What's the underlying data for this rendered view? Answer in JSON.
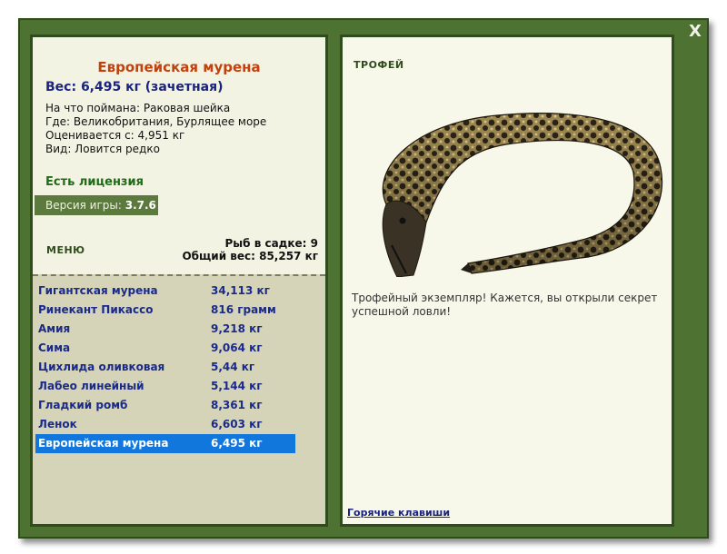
{
  "window": {
    "close_label": "X"
  },
  "fish": {
    "title": "Европейская мурена",
    "weight": "Вес: 6,495 кг (зачетная)",
    "caught_on": "На что поймана: Раковая шейка",
    "location": "Где: Великобритания, Бурлящее море",
    "valued_from": "Оценивается с: 4,951 кг",
    "rarity": "Вид: Ловится редко"
  },
  "license": "Есть лицензия",
  "version": {
    "label": "Версия игры:",
    "value": "3.7.6"
  },
  "menu_label": "МЕНЮ",
  "stats": {
    "fish_count": "Рыб в садке: 9",
    "total_weight": "Общий вес: 85,257 кг"
  },
  "catch_list": [
    {
      "name": "Гигантская мурена",
      "weight": "34,113 кг"
    },
    {
      "name": "Ринекант Пикассо",
      "weight": "816 грамм"
    },
    {
      "name": "Амия",
      "weight": "9,218 кг"
    },
    {
      "name": "Сима",
      "weight": "9,064 кг"
    },
    {
      "name": "Цихлида оливковая",
      "weight": "5,44 кг"
    },
    {
      "name": "Лабео линейный",
      "weight": "5,144 кг"
    },
    {
      "name": "Гладкий ромб",
      "weight": "8,361 кг"
    },
    {
      "name": "Ленок",
      "weight": "6,603 кг"
    },
    {
      "name": "Европейская мурена",
      "weight": "6,495 кг"
    }
  ],
  "trophy": {
    "label": "ТРОФЕЙ",
    "text": "Трофейный экземпляр! Кажется, вы открыли секрет успешной ловли!"
  },
  "hotkeys_link": "Горячие клавиши",
  "colors": {
    "frame": "#4d7232",
    "title": "#c2410c",
    "selected": "#1177dd"
  }
}
